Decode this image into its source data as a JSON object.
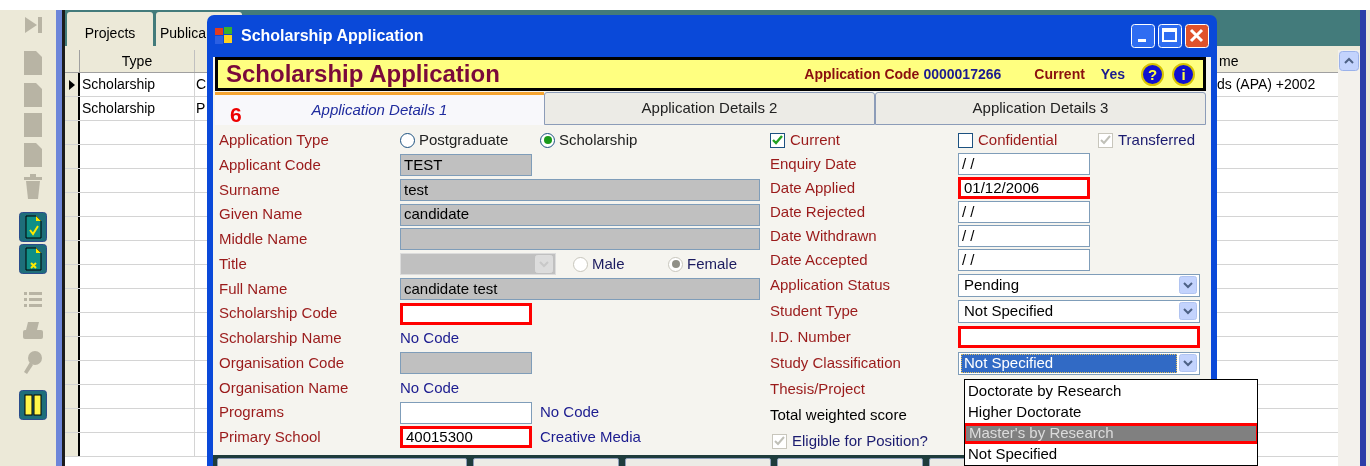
{
  "background_app": {
    "tabs": [
      {
        "label": "Projects",
        "selected": false
      },
      {
        "label": "Publica",
        "selected": false
      }
    ],
    "table": {
      "columns": {
        "type": "Type",
        "column_3": "me"
      },
      "rows": [
        {
          "type": "Scholarship",
          "column_2": "C",
          "column_3": "ds (APA) +2002",
          "current": true
        },
        {
          "type": "Scholarship",
          "column_2": "P",
          "current": false
        }
      ]
    }
  },
  "dialog": {
    "title": "Scholarship Application",
    "header": {
      "heading": "Scholarship Application",
      "code_label": "Application Code",
      "code": "0000017266",
      "current_label": "Current",
      "current_value": "Yes",
      "help_glyph": "?",
      "info_glyph": "i"
    },
    "annotation": "6",
    "tabs": [
      {
        "label": "Application Details 1",
        "selected": true
      },
      {
        "label": "Application Details 2",
        "selected": false
      },
      {
        "label": "Application Details 3",
        "selected": false
      }
    ],
    "left_fields": [
      {
        "kind": "radios",
        "label": "Application Type",
        "options": [
          {
            "label": "Postgraduate",
            "selected": false
          },
          {
            "label": "Scholarship",
            "selected": true
          }
        ]
      },
      {
        "kind": "short_field",
        "label": "Applicant Code",
        "value": "TEST",
        "editable": false,
        "highlighted": false
      },
      {
        "kind": "long_field",
        "label": "Surname",
        "value": "test",
        "editable": false,
        "highlighted": false
      },
      {
        "kind": "long_field",
        "label": "Given Name",
        "value": "candidate",
        "editable": false,
        "highlighted": false
      },
      {
        "kind": "long_field",
        "label": "Middle Name",
        "editable": false,
        "highlighted": false
      },
      {
        "kind": "title_select",
        "label": "Title",
        "options": [
          {
            "label": "Male",
            "selected": false
          },
          {
            "label": "Female",
            "selected": true
          }
        ]
      },
      {
        "kind": "long_field",
        "label": "Full Name",
        "value": "candidate test",
        "editable": false,
        "highlighted": false
      },
      {
        "kind": "short_field",
        "label": "Scholarship Code",
        "editable": true,
        "highlighted": true
      },
      {
        "kind": "note",
        "label": "Scholarship Name",
        "note": "No Code"
      },
      {
        "kind": "short_field",
        "label": "Organisation Code",
        "editable": false,
        "highlighted": false
      },
      {
        "kind": "note",
        "label": "Organisation Name",
        "note": "No Code"
      },
      {
        "kind": "short_field",
        "label": "Programs",
        "editable": true,
        "highlighted": false,
        "note": "No Code"
      },
      {
        "kind": "short_field",
        "label": "Primary School",
        "value": "40015300",
        "editable": true,
        "highlighted": true,
        "note": "Creative Media"
      }
    ],
    "right_fields": [
      {
        "kind": "checks",
        "checks": [
          {
            "label": "Current",
            "checked": true,
            "disabled": false
          },
          {
            "label": "Confidential",
            "checked": false,
            "disabled": false
          },
          {
            "label": "Transferred",
            "checked": true,
            "disabled": true
          }
        ]
      },
      {
        "kind": "date_field",
        "label": "Enquiry Date",
        "value": "/ /",
        "highlighted": false
      },
      {
        "kind": "date_field",
        "label": "Date Applied",
        "value": "01/12/2006",
        "highlighted": true
      },
      {
        "kind": "date_field",
        "label": "Date Rejected",
        "value": "/ /",
        "highlighted": false
      },
      {
        "kind": "date_field",
        "label": "Date Withdrawn",
        "value": "/ /",
        "highlighted": false
      },
      {
        "kind": "date_field",
        "label": "Date Accepted",
        "value": "/ /",
        "highlighted": false
      },
      {
        "kind": "select",
        "label": "Application Status",
        "value": "Pending",
        "focused": false
      },
      {
        "kind": "select",
        "label": "Student Type",
        "value": "Not Specified",
        "focused": false
      },
      {
        "kind": "wide_field",
        "label": "I.D. Number",
        "highlighted": true
      },
      {
        "kind": "select",
        "label": "Study Classification",
        "value": "Not Specified",
        "focused": true
      },
      {
        "kind": "label_only",
        "label": "Thesis/Project"
      },
      {
        "kind": "plain_label",
        "label": "Total weighted score"
      },
      {
        "kind": "check",
        "label": "Eligible for Position?",
        "checked": true,
        "disabled": true
      }
    ],
    "dropdown_list": [
      {
        "label": "Doctorate by Research",
        "selected": false,
        "highlighted": false
      },
      {
        "label": "Higher Doctorate",
        "selected": false,
        "highlighted": false
      },
      {
        "label": "Master's by Research",
        "selected": true,
        "highlighted": true
      },
      {
        "label": "Not Specified",
        "selected": false,
        "highlighted": false
      }
    ]
  }
}
